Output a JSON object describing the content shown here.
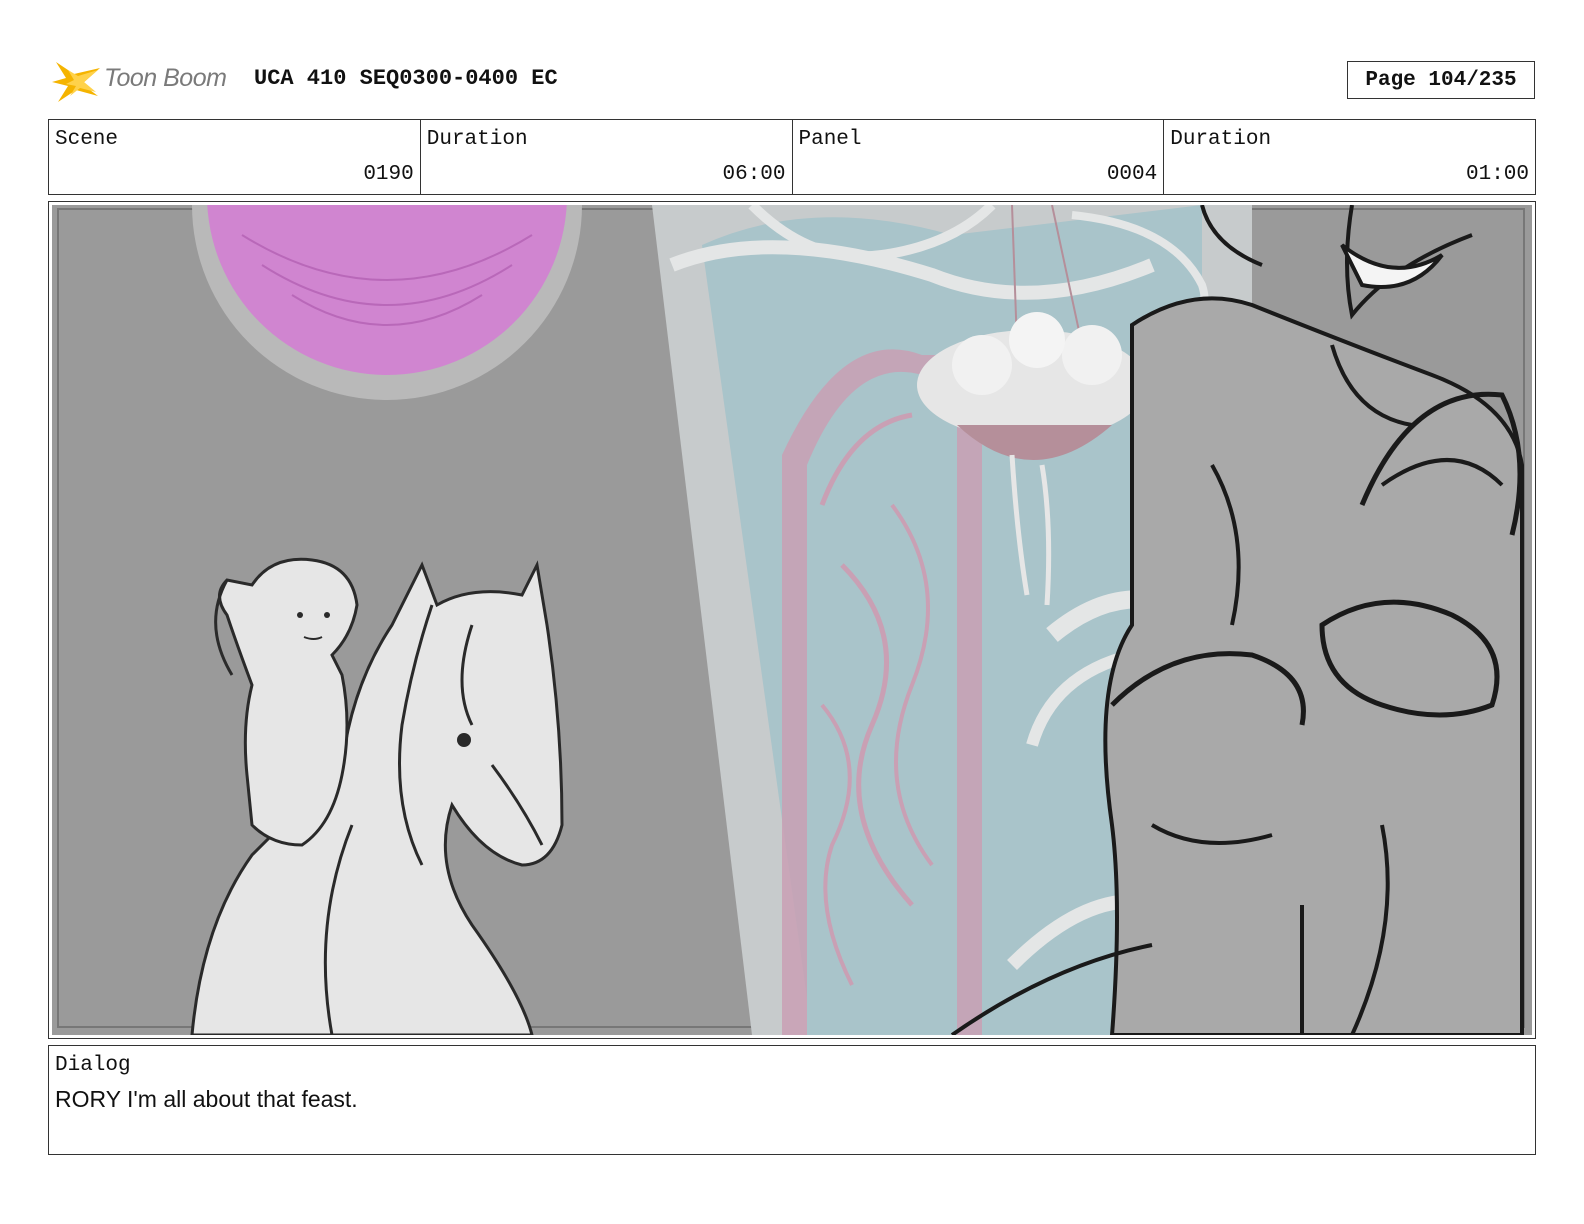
{
  "header": {
    "logo_text": "Toon Boom",
    "title": "UCA 410 SEQ0300-0400 EC",
    "page": "Page 104/235"
  },
  "info": {
    "scene_label": "Scene",
    "scene_value": "0190",
    "scene_duration_label": "Duration",
    "scene_duration_value": "06:00",
    "panel_label": "Panel",
    "panel_value": "0004",
    "panel_duration_label": "Duration",
    "panel_duration_value": "01:00"
  },
  "dialog": {
    "label": "Dialog",
    "text": "RORY I'm all about that feast."
  },
  "colors": {
    "logo_accent": "#f5b400",
    "wall_gray": "#9a9a9a",
    "window_blue": "#a9c4ca",
    "pink_trim": "#c9a0b4",
    "magenta_circle": "#d085d0"
  }
}
